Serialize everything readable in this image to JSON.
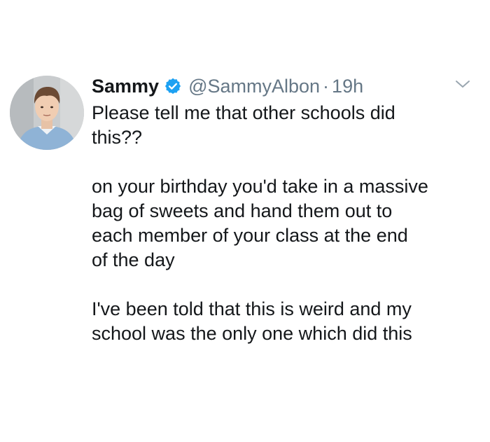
{
  "tweet": {
    "display_name": "Sammy",
    "handle": "@SammyAlbon",
    "separator": "·",
    "time": "19h",
    "verified": true,
    "accent_color": "#1da1f2",
    "avatar_icon": "profile-photo",
    "menu_icon": "chevron-down-icon",
    "paragraphs": [
      "Please tell me that other schools did\nthis??",
      "on your birthday you'd take in a massive\nbag of sweets and hand them out to\neach member of your class at the end\nof the day",
      "I've been told that this is weird and my\nschool was the only one which did this"
    ]
  }
}
